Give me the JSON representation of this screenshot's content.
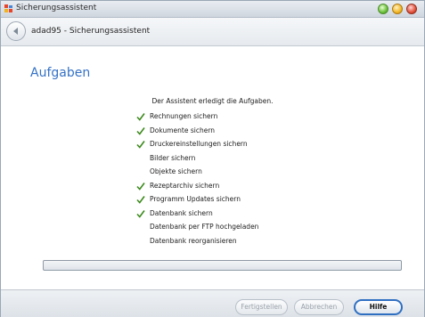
{
  "window": {
    "title": "Sicherungsassistent"
  },
  "nav": {
    "title": "adad95 - Sicherungsassistent"
  },
  "content": {
    "section_title": "Aufgaben",
    "intro": "Der Assistent erledigt die Aufgaben.",
    "tasks": [
      {
        "label": "Rechnungen sichern",
        "done": true
      },
      {
        "label": "Dokumente sichern",
        "done": true
      },
      {
        "label": "Druckereinstellungen sichern",
        "done": true
      },
      {
        "label": "Bilder sichern",
        "done": false
      },
      {
        "label": "Objekte sichern",
        "done": false
      },
      {
        "label": "Rezeptarchiv sichern",
        "done": true
      },
      {
        "label": "Programm Updates sichern",
        "done": true
      },
      {
        "label": "Datenbank sichern",
        "done": true
      },
      {
        "label": "Datenbank per FTP hochgeladen",
        "done": false
      },
      {
        "label": "Datenbank reorganisieren",
        "done": false
      }
    ],
    "progress": 0
  },
  "footer": {
    "finish_label": "Fertigstellen",
    "cancel_label": "Abbrechen",
    "help_label": "Hilfe"
  },
  "colors": {
    "accent": "#3572c6",
    "check": "#3d8a1e"
  }
}
